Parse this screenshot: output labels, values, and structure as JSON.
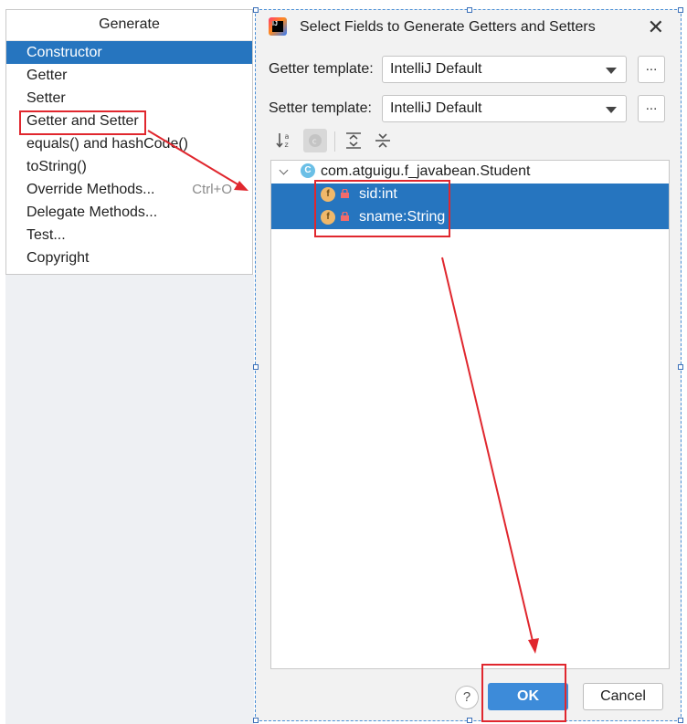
{
  "generate_menu": {
    "title": "Generate",
    "items": [
      {
        "label": "Constructor",
        "shortcut": ""
      },
      {
        "label": "Getter",
        "shortcut": ""
      },
      {
        "label": "Setter",
        "shortcut": ""
      },
      {
        "label": "Getter and Setter",
        "shortcut": ""
      },
      {
        "label": "equals() and hashCode()",
        "shortcut": ""
      },
      {
        "label": "toString()",
        "shortcut": ""
      },
      {
        "label": "Override Methods...",
        "shortcut": "Ctrl+O"
      },
      {
        "label": "Delegate Methods...",
        "shortcut": ""
      },
      {
        "label": "Test...",
        "shortcut": ""
      },
      {
        "label": "Copyright",
        "shortcut": ""
      }
    ],
    "selected_index": 0
  },
  "dialog": {
    "title": "Select Fields to Generate Getters and Setters",
    "close_glyph": "✕",
    "getter_label": "Getter template:",
    "getter_value": "IntelliJ Default",
    "setter_label": "Setter template:",
    "setter_value": "IntelliJ Default",
    "browse_label": "...",
    "tree": {
      "class_icon": "C",
      "class_name": "com.atguigu.f_javabean.Student",
      "field_icon": "f",
      "fields": [
        "sid:int",
        "sname:String"
      ]
    },
    "help_label": "?",
    "ok_label": "OK",
    "cancel_label": "Cancel"
  },
  "colors": {
    "selection": "#2675bf",
    "ok_button": "#3d8bd9",
    "annotation": "#e0272e"
  }
}
